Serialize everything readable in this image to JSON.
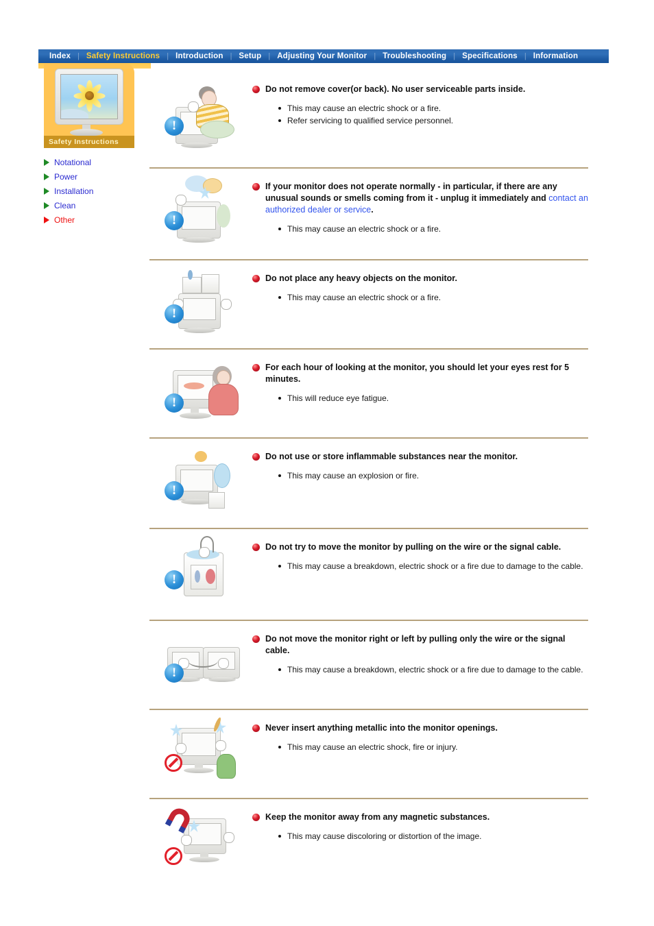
{
  "nav": {
    "items": [
      {
        "label": "Index",
        "active": false
      },
      {
        "label": "Safety Instructions",
        "active": true
      },
      {
        "label": "Introduction",
        "active": false
      },
      {
        "label": "Setup",
        "active": false
      },
      {
        "label": "Adjusting Your Monitor",
        "active": false
      },
      {
        "label": "Troubleshooting",
        "active": false
      },
      {
        "label": "Specifications",
        "active": false
      },
      {
        "label": "Information",
        "active": false
      }
    ],
    "separator": "|"
  },
  "sidebar": {
    "banner_label": "Safety Instructions",
    "banner_icon": "monitor-sunflower-image",
    "links": [
      {
        "label": "Notational",
        "active": false
      },
      {
        "label": "Power",
        "active": false
      },
      {
        "label": "Installation",
        "active": false
      },
      {
        "label": "Clean",
        "active": false
      },
      {
        "label": "Other",
        "active": true
      }
    ]
  },
  "colors": {
    "nav_background": "#2f6cb4",
    "nav_active_text": "#ffcc33",
    "nav_underline": "#ffc94d",
    "banner_background": "#ffc453",
    "banner_label_background": "#c9931f",
    "separator_rule": "#b6a27d",
    "link_blue": "#3355ee",
    "sidebar_link": "#2a2ad0",
    "sidebar_active": "#ee1111",
    "bullet_red": "#d81a2a",
    "warning_blue": "#2b8fd8",
    "prohibition_red": "#e2202a"
  },
  "sections": [
    {
      "figure": "monitor-person-removing-cover-illustration",
      "headline": "Do not remove cover(or back). No user serviceable parts inside.",
      "link_text": "",
      "headline_tail": "",
      "bullets": [
        "This may cause an electric shock or a fire.",
        "Refer servicing to qualified service personnel."
      ]
    },
    {
      "figure": "monitor-smoke-smell-illustration",
      "headline": "If your monitor does not operate normally - in particular, if there are any unusual sounds or smells coming from it - unplug it immediately and ",
      "link_text": "contact an authorized dealer or service",
      "headline_tail": ".",
      "bullets": [
        "This may cause an electric shock or a fire."
      ]
    },
    {
      "figure": "monitor-heavy-objects-illustration",
      "headline": "Do not place any heavy objects on the monitor.",
      "link_text": "",
      "headline_tail": "",
      "bullets": [
        "This may cause an electric shock or a fire."
      ]
    },
    {
      "figure": "monitor-eye-rest-illustration",
      "headline": "For each hour of looking at the monitor, you should let your eyes rest for 5 minutes.",
      "link_text": "",
      "headline_tail": "",
      "bullets": [
        "This will reduce eye fatigue."
      ]
    },
    {
      "figure": "monitor-inflammable-substances-illustration",
      "headline": "Do not use or store inflammable substances near the monitor.",
      "link_text": "",
      "headline_tail": "",
      "bullets": [
        "This may cause an explosion or fire."
      ]
    },
    {
      "figure": "monitor-pulling-wire-illustration",
      "headline": "Do not try to move the monitor by pulling on the wire or the signal cable.",
      "link_text": "",
      "headline_tail": "",
      "bullets": [
        "This may cause a breakdown, electric shock or a fire due to damage to the cable."
      ]
    },
    {
      "figure": "monitor-move-left-right-illustration",
      "headline": "Do not move the monitor right or left by pulling only the wire or the signal cable.",
      "link_text": "",
      "headline_tail": "",
      "bullets": [
        "This may cause a breakdown, electric shock or a fire due to damage to the cable."
      ]
    },
    {
      "figure": "monitor-metallic-object-openings-illustration",
      "headline": "Never insert anything metallic into the monitor openings.",
      "link_text": "",
      "headline_tail": "",
      "bullets": [
        "This may cause an electric shock, fire or injury."
      ]
    },
    {
      "figure": "monitor-magnetic-substances-illustration",
      "headline": "Keep the monitor away from any magnetic substances.",
      "link_text": "",
      "headline_tail": "",
      "bullets": [
        "This may cause discoloring or distortion of the image."
      ]
    }
  ]
}
